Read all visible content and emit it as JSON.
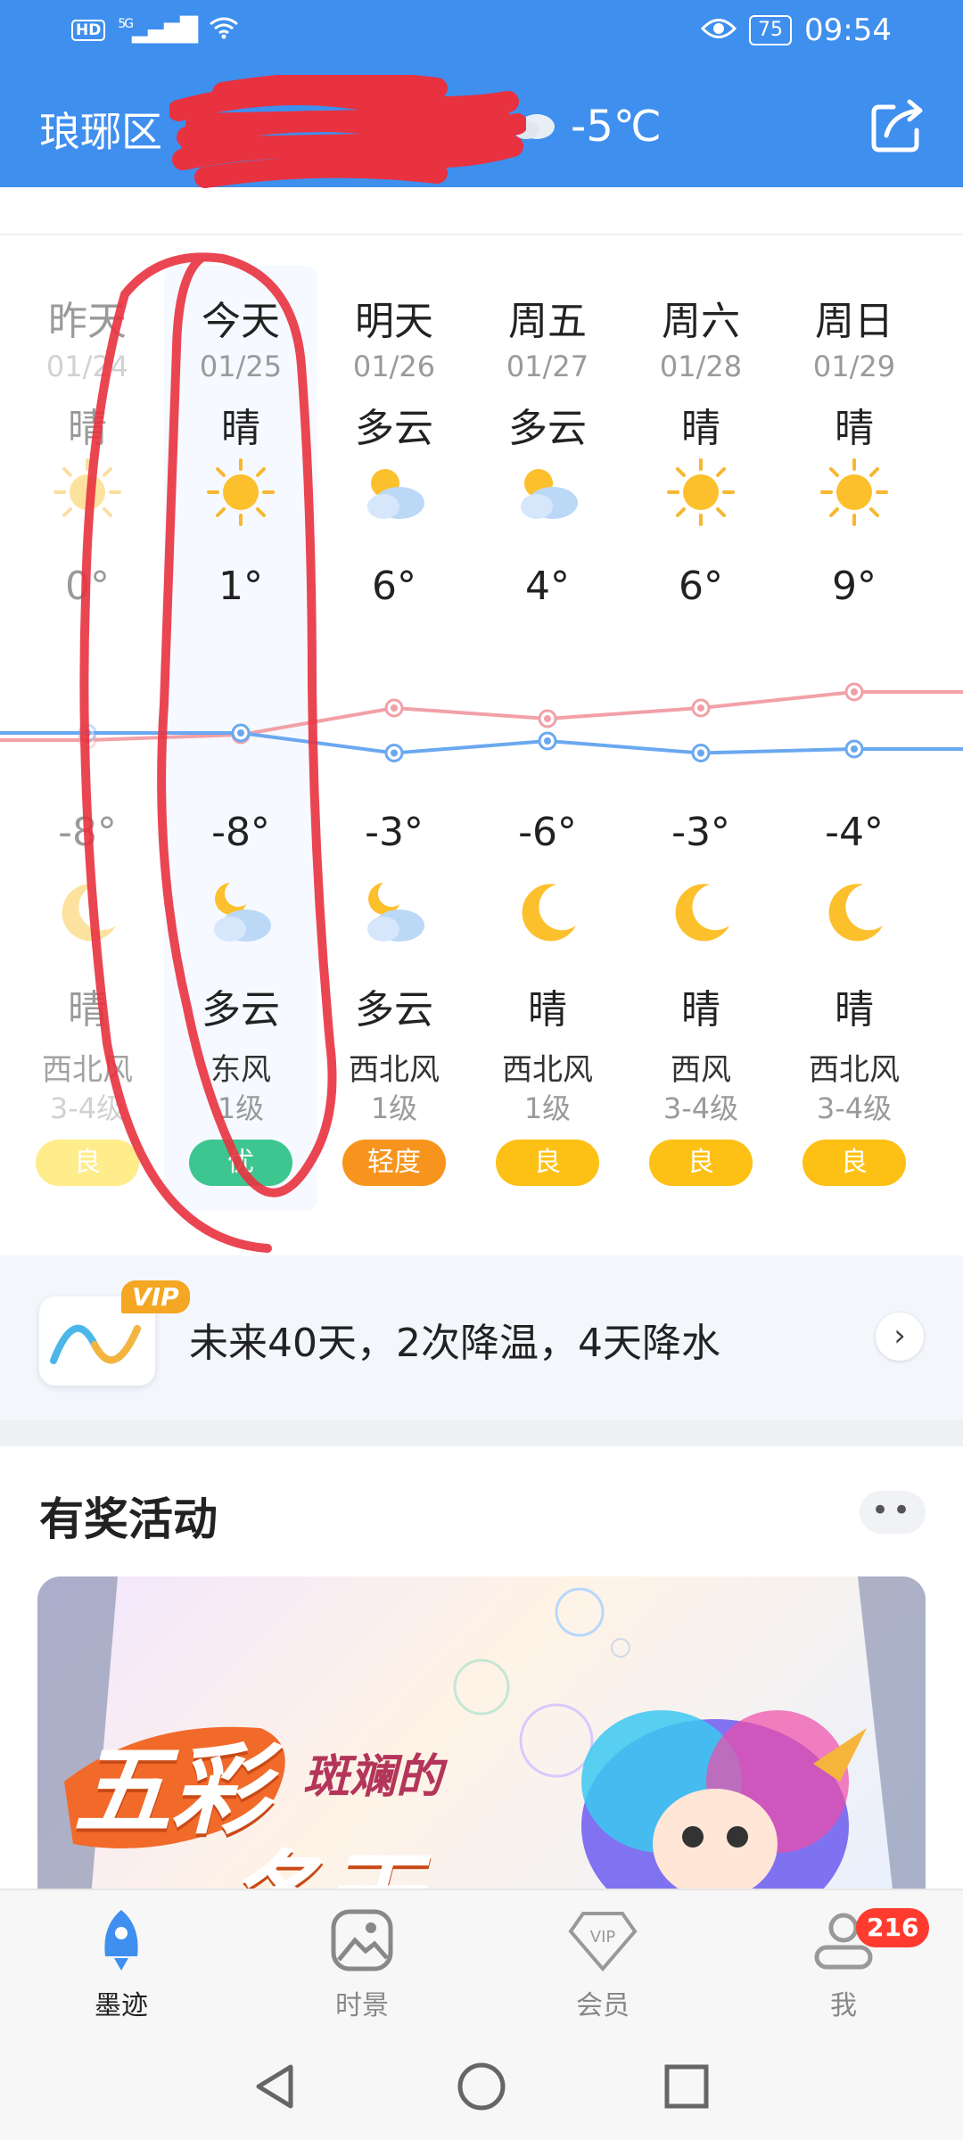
{
  "status_bar": {
    "hd": "HD",
    "signal": "5G",
    "battery": "75",
    "time": "09:54"
  },
  "header": {
    "location": "琅琊区",
    "temp": "-5℃"
  },
  "forecast": {
    "days": [
      {
        "name": "昨天",
        "date": "01/24",
        "day_cond": "晴",
        "high": "0°",
        "low": "-8°",
        "night_cond": "晴",
        "wind": "西北风",
        "level": "3-4级",
        "aqi": "良",
        "aqi_color": "#ffd700",
        "day_icon": "sun-icon",
        "night_icon": "moon-icon"
      },
      {
        "name": "今天",
        "date": "01/25",
        "day_cond": "晴",
        "high": "1°",
        "low": "-8°",
        "night_cond": "多云",
        "wind": "东风",
        "level": "1级",
        "aqi": "优",
        "aqi_color": "#3ec690",
        "day_icon": "sun-icon",
        "night_icon": "moon-cloud-icon"
      },
      {
        "name": "明天",
        "date": "01/26",
        "day_cond": "多云",
        "high": "6°",
        "low": "-3°",
        "night_cond": "多云",
        "wind": "西北风",
        "level": "1级",
        "aqi": "轻度",
        "aqi_color": "#f7941d",
        "day_icon": "sun-cloud-icon",
        "night_icon": "moon-cloud-icon"
      },
      {
        "name": "周五",
        "date": "01/27",
        "day_cond": "多云",
        "high": "4°",
        "low": "-6°",
        "night_cond": "晴",
        "wind": "西北风",
        "level": "1级",
        "aqi": "良",
        "aqi_color": "#fdc015",
        "day_icon": "sun-cloud-icon",
        "night_icon": "moon-icon"
      },
      {
        "name": "周六",
        "date": "01/28",
        "day_cond": "晴",
        "high": "6°",
        "low": "-3°",
        "night_cond": "晴",
        "wind": "西风",
        "level": "3-4级",
        "aqi": "良",
        "aqi_color": "#fdc015",
        "day_icon": "sun-icon",
        "night_icon": "moon-icon"
      },
      {
        "name": "周日",
        "date": "01/29",
        "day_cond": "晴",
        "high": "9°",
        "low": "-4°",
        "night_cond": "晴",
        "wind": "西北风",
        "level": "3-4级",
        "aqi": "良",
        "aqi_color": "#fdc015",
        "day_icon": "sun-icon",
        "night_icon": "moon-icon"
      }
    ]
  },
  "vip": {
    "tag": "VIP",
    "text": "未来40天，2次降温，4天降水"
  },
  "activities": {
    "title": "有奖活动",
    "banner_text_1": "五彩",
    "banner_text_2": "斑斓的",
    "banner_text_3": "冬天"
  },
  "bottom_nav": [
    {
      "label": "墨迹",
      "active": true
    },
    {
      "label": "时景",
      "active": false
    },
    {
      "label": "会员",
      "active": false
    },
    {
      "label": "我",
      "active": false,
      "badge": "216"
    }
  ],
  "colors": {
    "primary": "#3f8fef",
    "high_line": "#f2a0a8",
    "low_line": "#6aa8f0"
  }
}
